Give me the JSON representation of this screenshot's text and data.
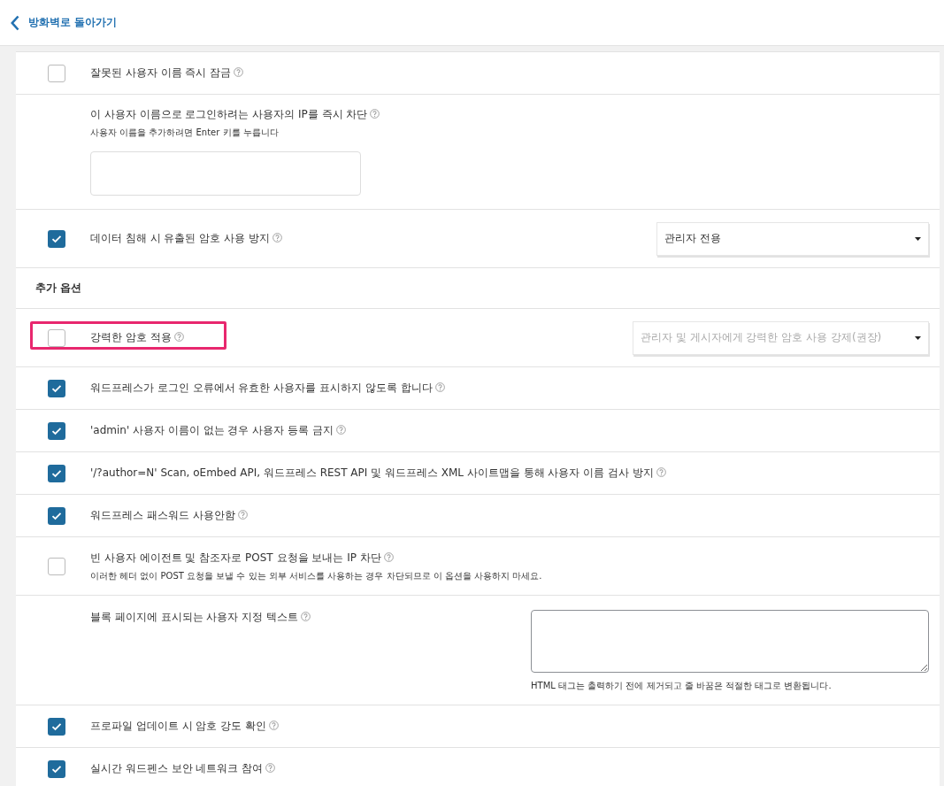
{
  "back_link": {
    "label": "방화벽로 돌아가기"
  },
  "rows": [
    {
      "kind": "checkbox",
      "label": "잘못된 사용자 이름 즉시 잠금",
      "checked": false,
      "highlighted": false
    },
    {
      "kind": "tags",
      "label": "이 사용자 이름으로 로그인하려는 사용자의 IP를 즉시 차단",
      "hint": "사용자 이름을 추가하려면 Enter 키를 누릅니다"
    },
    {
      "kind": "checkbox",
      "label": "데이터 침해 시 유출된 암호 사용 방지",
      "checked": true,
      "highlighted": false,
      "select": {
        "value": "관리자 전용",
        "disabled": false
      }
    },
    {
      "kind": "heading",
      "label": "추가 옵션"
    },
    {
      "kind": "checkbox",
      "label": "강력한 암호 적용",
      "checked": false,
      "highlighted": true,
      "select": {
        "value": "관리자 및 게시자에게 강력한 암호 사용 강제(권장)",
        "disabled": true
      }
    },
    {
      "kind": "checkbox",
      "label": "워드프레스가 로그인 오류에서 유효한 사용자를 표시하지 않도록 합니다",
      "checked": true,
      "highlighted": false
    },
    {
      "kind": "checkbox",
      "label": "'admin' 사용자 이름이 없는 경우 사용자 등록 금지",
      "checked": true,
      "highlighted": false
    },
    {
      "kind": "checkbox",
      "label": "'/?author=N' Scan, oEmbed API, 워드프레스 REST API 및 워드프레스 XML 사이트맵을 통해 사용자 이름 검사 방지",
      "checked": true,
      "highlighted": false
    },
    {
      "kind": "checkbox",
      "label": "워드프레스 패스워드 사용안함",
      "checked": true,
      "highlighted": false
    },
    {
      "kind": "checkbox",
      "label": "빈 사용자 에이전트 및 참조자로 POST 요청을 보내는 IP 차단",
      "checked": false,
      "highlighted": false,
      "hint": "이러한 헤더 없이 POST 요청을 보낼 수 있는 외부 서비스를 사용하는 경우 차단되므로 이 옵션을 사용하지 마세요."
    },
    {
      "kind": "textarea",
      "label": "블록 페이지에 표시되는 사용자 지정 텍스트",
      "hint": "HTML 태그는 출력하기 전에 제거되고 줄 바꿈은 적절한 태그로 변환됩니다."
    },
    {
      "kind": "checkbox",
      "label": "프로파일 업데이트 시 암호 강도 확인",
      "checked": true,
      "highlighted": false
    },
    {
      "kind": "checkbox",
      "label": "실시간 워드펜스 보안 네트워크 참여",
      "checked": true,
      "highlighted": false
    }
  ]
}
